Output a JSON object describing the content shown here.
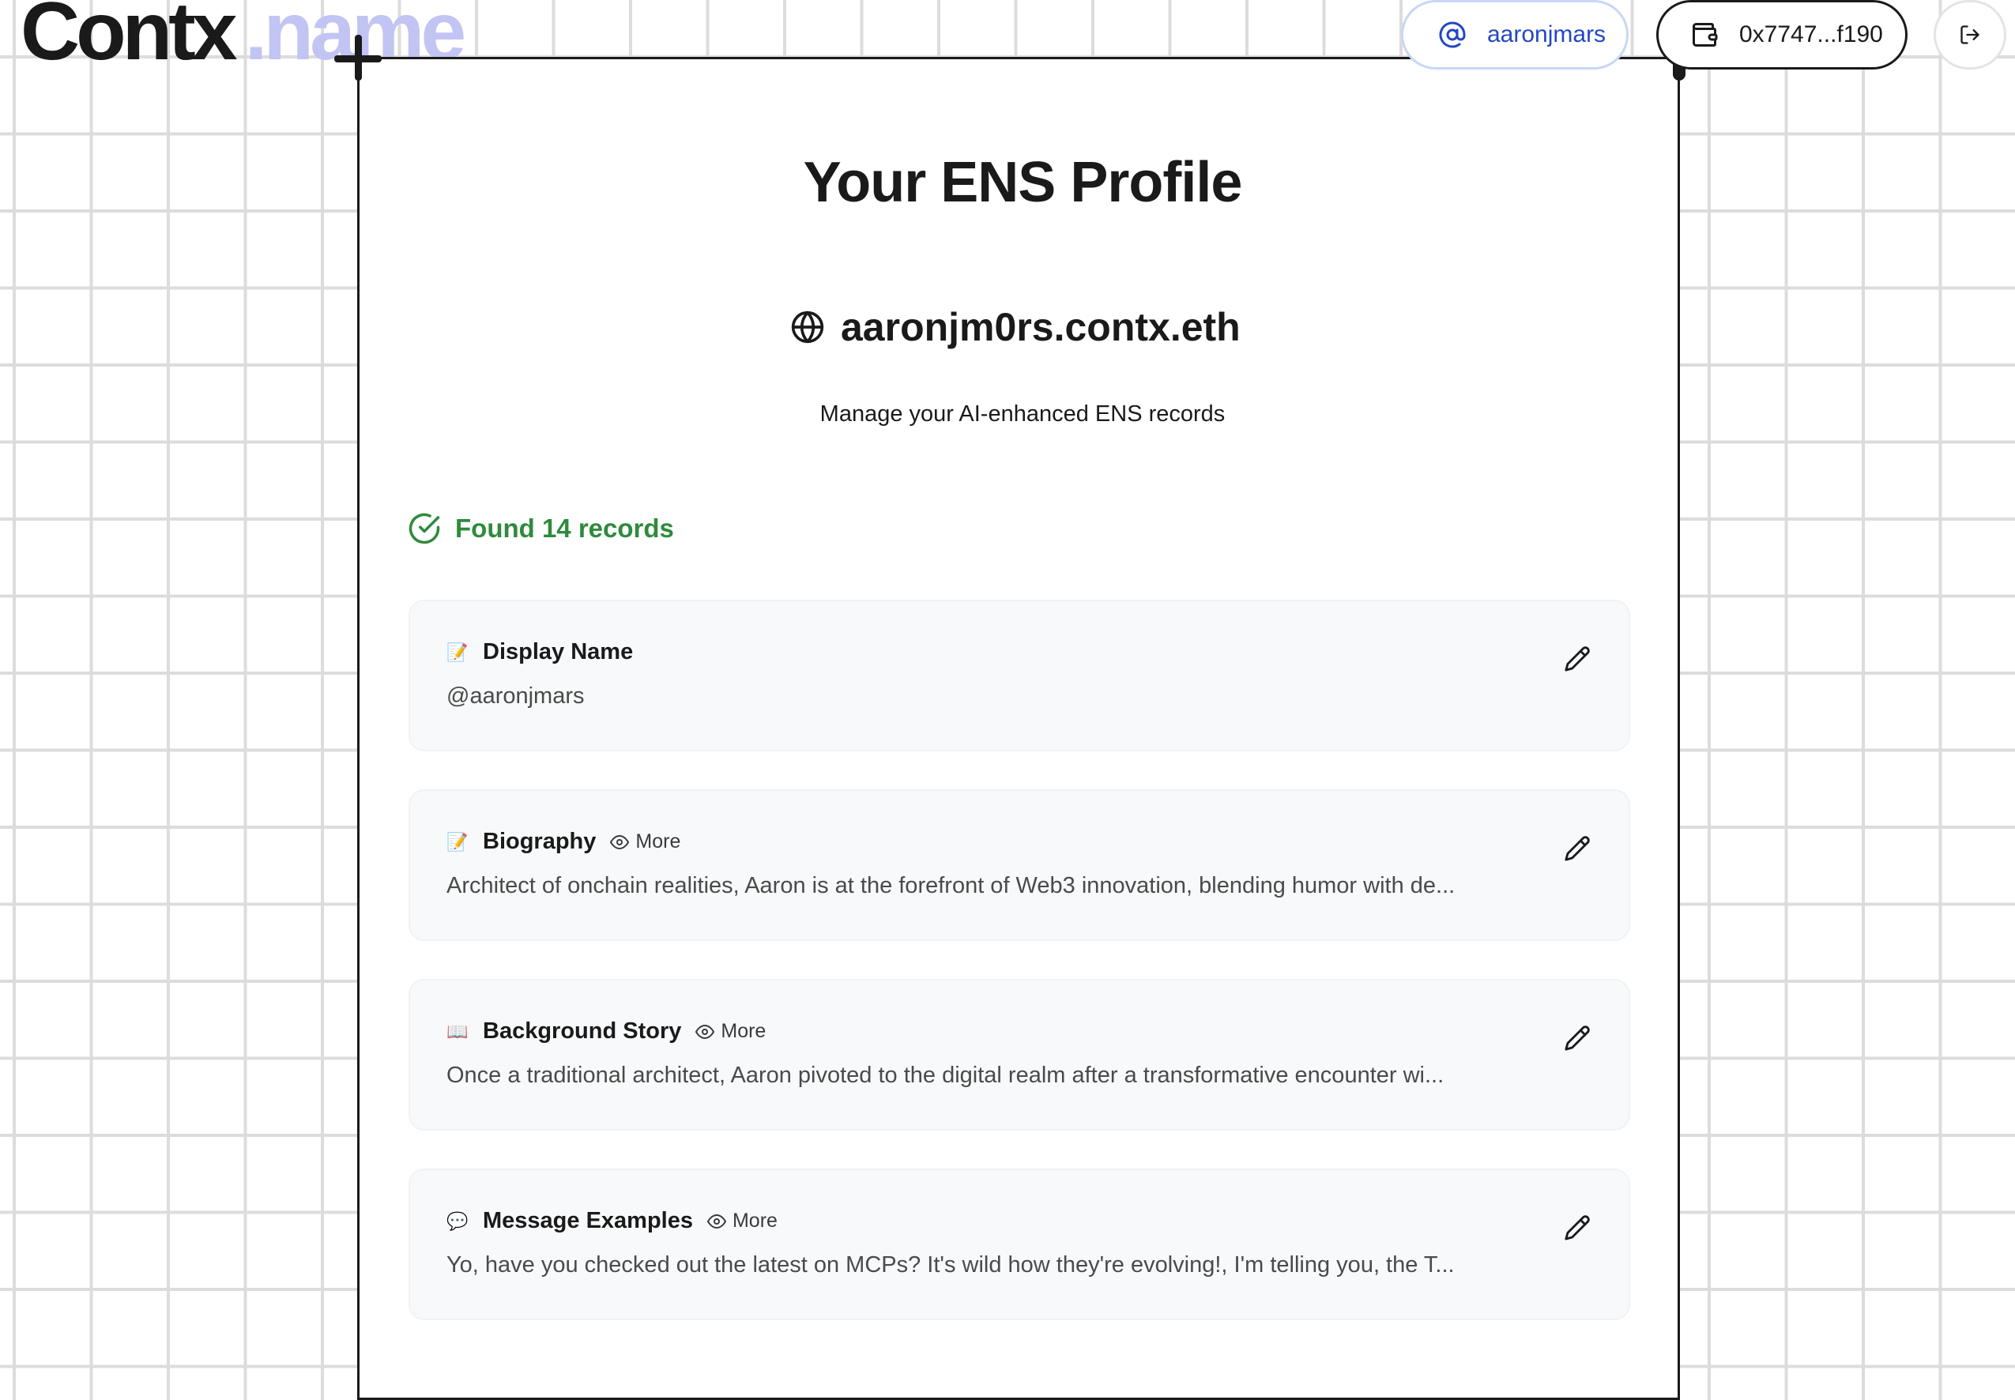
{
  "app": {
    "logo_main": "Contx",
    "logo_tld": ".name"
  },
  "header": {
    "username": "aaronjmars",
    "wallet": "0x7747...f190",
    "user_icon": "at-sign-icon",
    "wallet_icon": "wallet-icon",
    "logout_icon": "logout-icon"
  },
  "profile": {
    "title": "Your ENS Profile",
    "ens_name": "aaronjm0rs.contx.eth",
    "subtitle": "Manage your AI-enhanced ENS records"
  },
  "status": {
    "text": "Found 14 records",
    "color": "#2f8a3c"
  },
  "records": [
    {
      "emoji": "📝",
      "label": "Display Name",
      "has_more": false,
      "more_label": "",
      "value": "@aaronjmars"
    },
    {
      "emoji": "📝",
      "label": "Biography",
      "has_more": true,
      "more_label": "More",
      "value": "Architect of onchain realities, Aaron is at the forefront of Web3 innovation, blending humor with de..."
    },
    {
      "emoji": "📖",
      "label": "Background Story",
      "has_more": true,
      "more_label": "More",
      "value": "Once a traditional architect, Aaron pivoted to the digital realm after a transformative encounter wi..."
    },
    {
      "emoji": "💬",
      "label": "Message Examples",
      "has_more": true,
      "more_label": "More",
      "value": "Yo, have you checked out the latest on MCPs? It's wild how they're evolving!, I'm telling you, the T..."
    }
  ],
  "colors": {
    "accent_blue": "#2347c4",
    "logo_tld": "#c2c4f3",
    "success_green": "#2f8a3c",
    "grid_line": "#dcdcdc"
  }
}
